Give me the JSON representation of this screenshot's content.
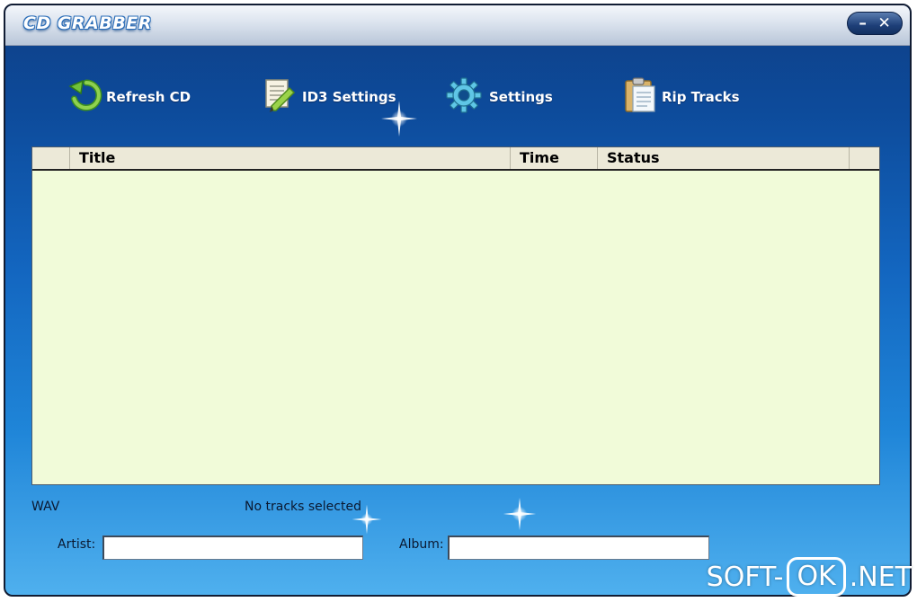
{
  "window": {
    "title": "CD GRABBER",
    "controls": {
      "minimize": "–",
      "close": "✕"
    }
  },
  "toolbar": {
    "items": [
      {
        "label": "Refresh CD",
        "icon": "refresh-icon"
      },
      {
        "label": "ID3 Settings",
        "icon": "edit-document-icon"
      },
      {
        "label": "Settings",
        "icon": "gear-icon"
      },
      {
        "label": "Rip Tracks",
        "icon": "clipboard-icon"
      }
    ]
  },
  "tracklist": {
    "columns": [
      "",
      "Title",
      "Time",
      "Status",
      ""
    ],
    "rows": []
  },
  "status": {
    "format": "WAV",
    "selection": "No tracks selected"
  },
  "metadata": {
    "artist_label": "Artist:",
    "artist_value": "",
    "album_label": "Album:",
    "album_value": ""
  },
  "watermark": {
    "left": "SOFT-",
    "boxed": "OK",
    "right": ".NET"
  },
  "colors": {
    "window_top": "#0e3f86",
    "window_bottom": "#4fb0ee",
    "grid_background": "#f1fbd9",
    "header_background": "#ece9d8"
  }
}
